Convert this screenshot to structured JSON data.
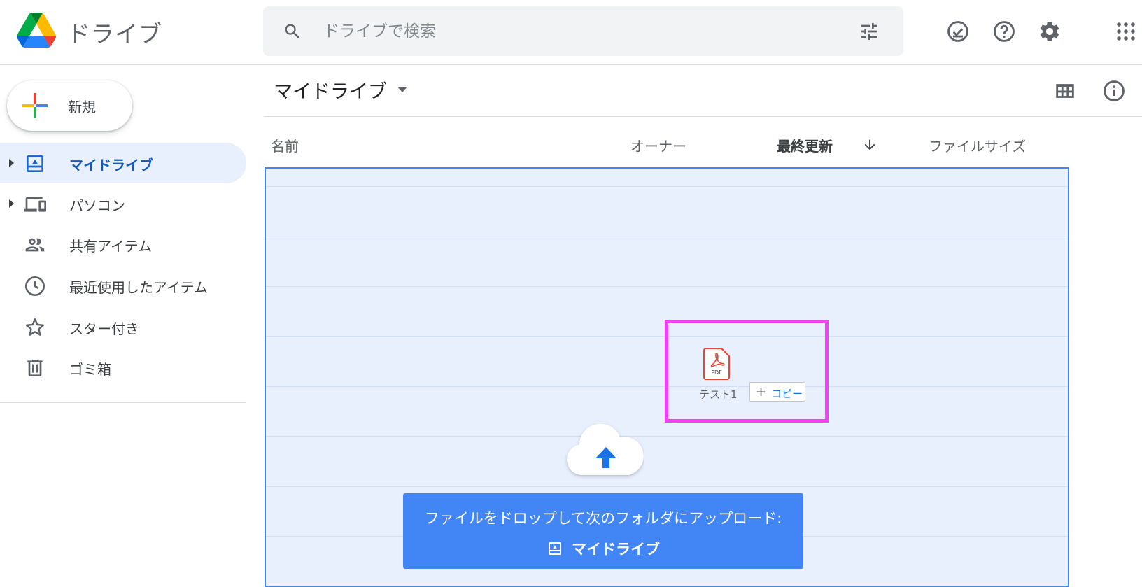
{
  "app": {
    "title": "ドライブ"
  },
  "search": {
    "placeholder": "ドライブで検索"
  },
  "sidebar": {
    "new_label": "新規",
    "items": [
      {
        "label": "マイドライブ",
        "icon": "my-drive-icon",
        "active": true,
        "expandable": true
      },
      {
        "label": "パソコン",
        "icon": "computers-icon",
        "active": false,
        "expandable": true
      },
      {
        "label": "共有アイテム",
        "icon": "shared-people-icon",
        "active": false,
        "expandable": false
      },
      {
        "label": "最近使用したアイテム",
        "icon": "clock-icon",
        "active": false,
        "expandable": false
      },
      {
        "label": "スター付き",
        "icon": "star-icon",
        "active": false,
        "expandable": false
      },
      {
        "label": "ゴミ箱",
        "icon": "trash-icon",
        "active": false,
        "expandable": false
      }
    ]
  },
  "main": {
    "breadcrumb": "マイドライブ",
    "columns": {
      "name": "名前",
      "owner": "オーナー",
      "modified": "最終更新",
      "size": "ファイルサイズ"
    }
  },
  "drag": {
    "file_name": "テスト1",
    "file_type_label": "PDF",
    "copy_label": "コピー"
  },
  "upload": {
    "message": "ファイルをドロップして次のフォルダにアップロード:",
    "target": "マイドライブ"
  },
  "colors": {
    "accent": "#4285f4",
    "active_nav_bg": "#e8f0fe",
    "active_nav_text": "#185abc",
    "highlight": "#f342f3"
  }
}
